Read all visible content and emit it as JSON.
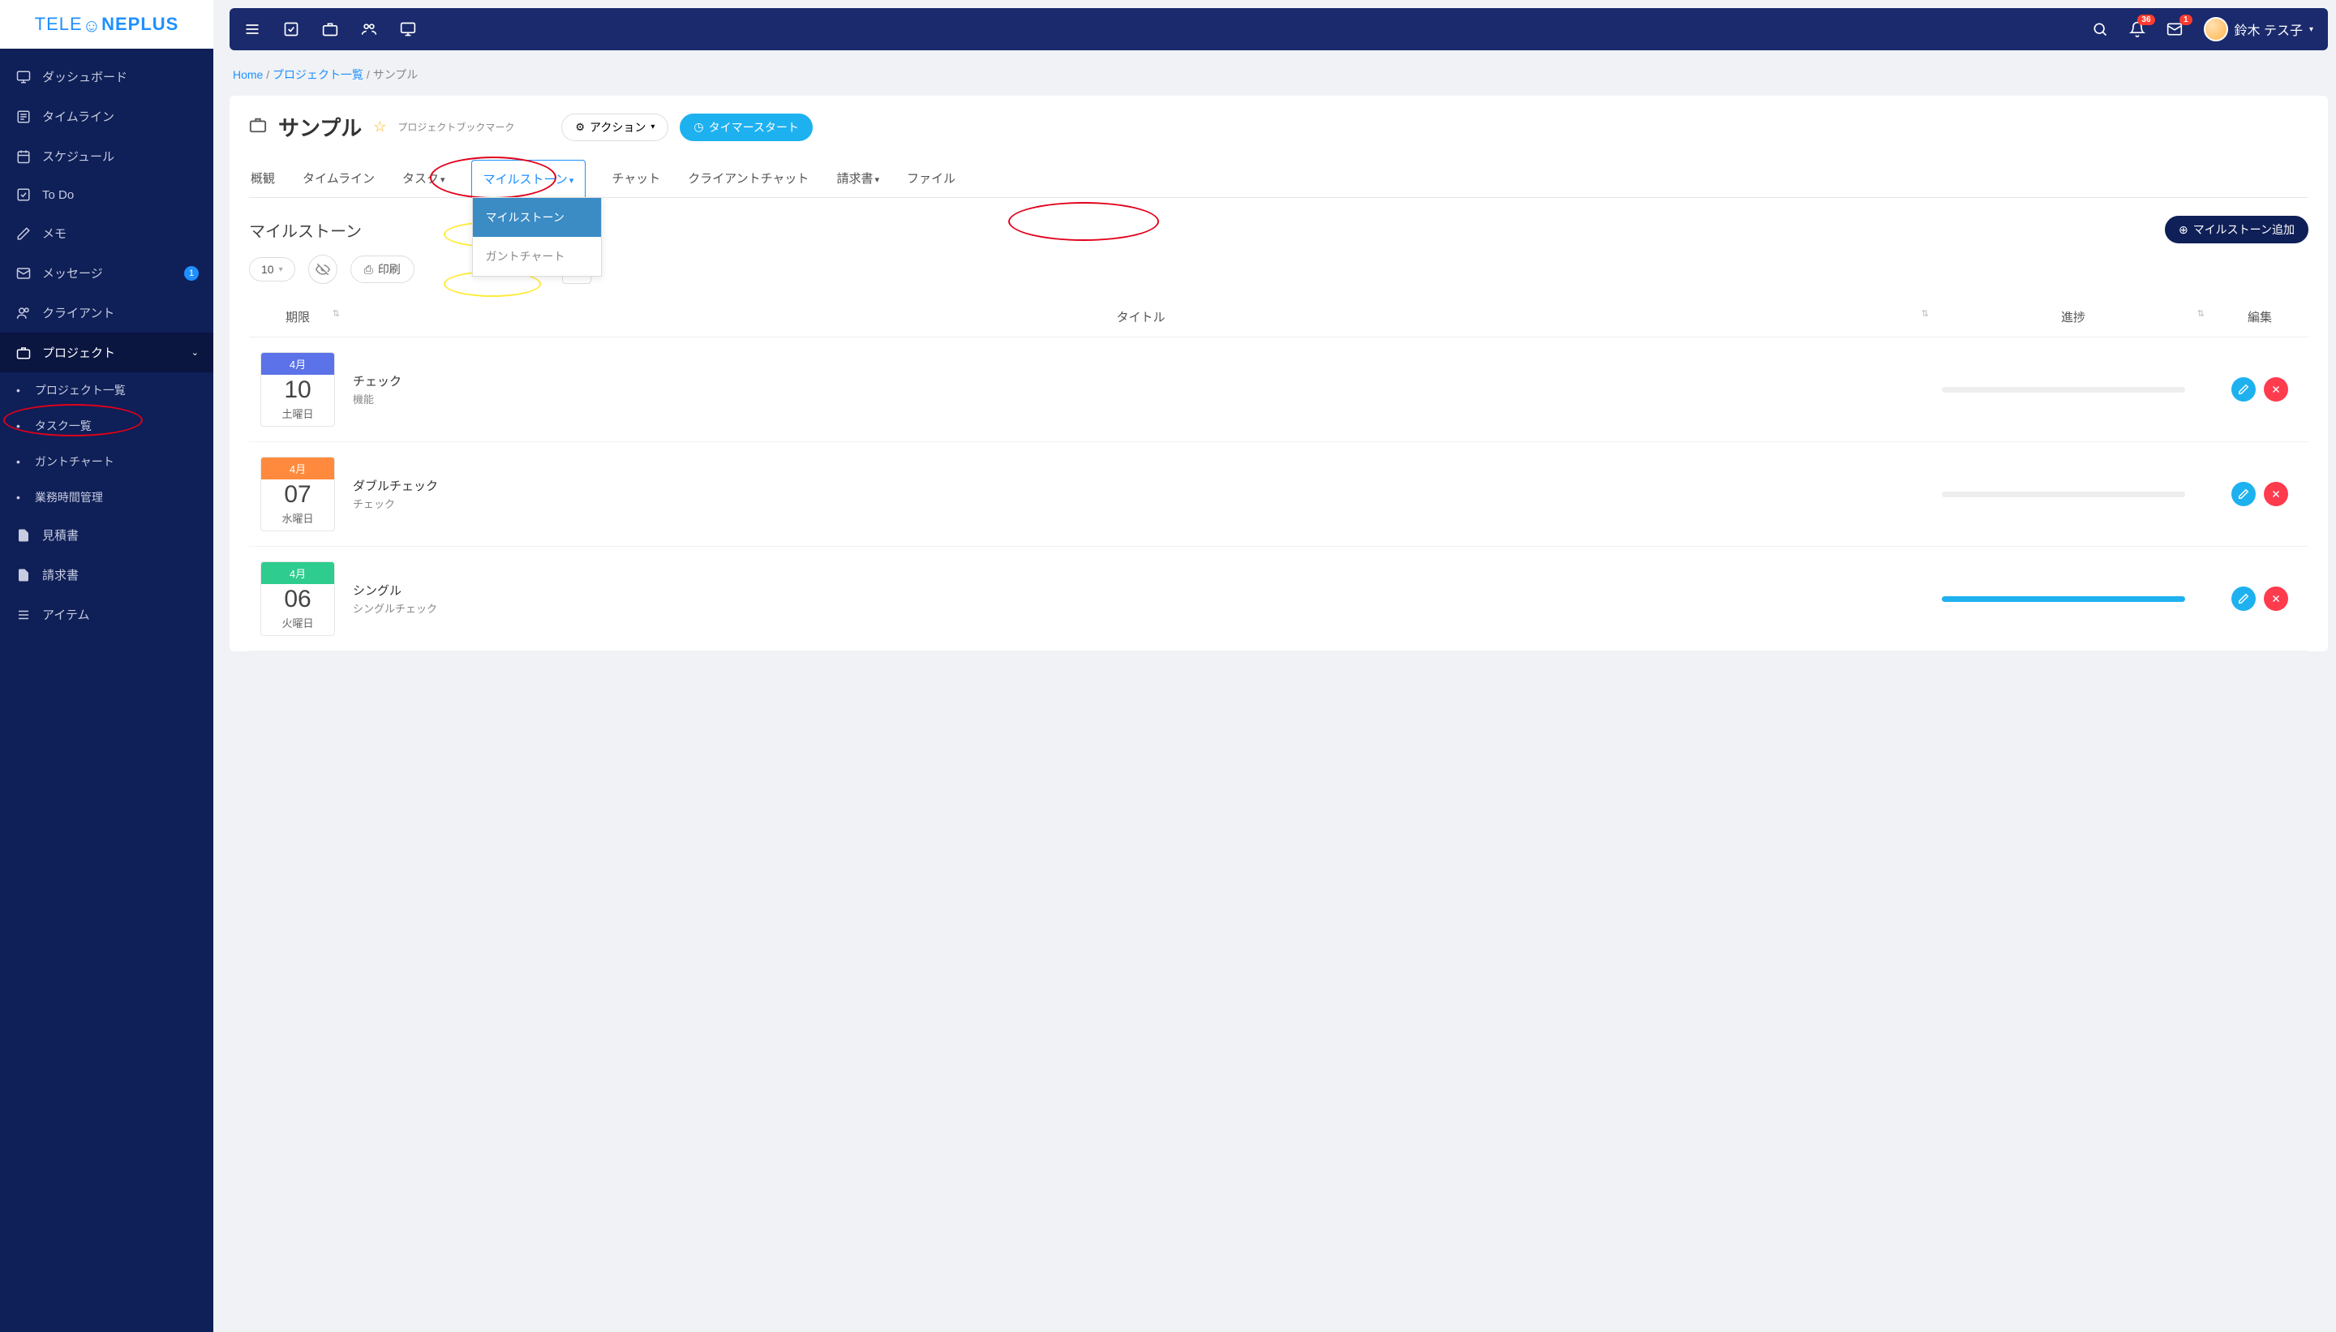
{
  "logo": {
    "t1": "TELE",
    "t2": "NEPLUS"
  },
  "sidebar": [
    {
      "label": "ダッシュボード"
    },
    {
      "label": "タイムライン"
    },
    {
      "label": "スケジュール"
    },
    {
      "label": "To Do"
    },
    {
      "label": "メモ"
    },
    {
      "label": "メッセージ",
      "badge": "1"
    },
    {
      "label": "クライアント"
    },
    {
      "label": "プロジェクト",
      "expand": true
    },
    {
      "label": "見積書"
    },
    {
      "label": "請求書"
    },
    {
      "label": "アイテム"
    }
  ],
  "sub": [
    {
      "label": "プロジェクト一覧"
    },
    {
      "label": "タスク一覧"
    },
    {
      "label": "ガントチャート"
    },
    {
      "label": "業務時間管理"
    }
  ],
  "topbar": {
    "bell_badge": "36",
    "mail_badge": "1",
    "user": "鈴木 テス子"
  },
  "breadcrumb": {
    "home": "Home",
    "list": "プロジェクト一覧",
    "current": "サンプル"
  },
  "project": {
    "title": "サンプル",
    "bookmark": "プロジェクトブックマーク",
    "action": "アクション",
    "timer": "タイマースタート"
  },
  "tabs": {
    "overview": "概観",
    "timeline": "タイムライン",
    "task": "タスク",
    "milestone": "マイルストーン",
    "chat": "チャット",
    "clientchat": "クライアントチャット",
    "invoice": "請求書",
    "file": "ファイル"
  },
  "dropdown": {
    "milestone": "マイルストーン",
    "gantt": "ガントチャート"
  },
  "section": {
    "heading": "マイルストーン",
    "add": "マイルストーン追加"
  },
  "toolbar": {
    "pagesize": "10",
    "print": "印刷"
  },
  "columns": {
    "due": "期限",
    "title": "タイトル",
    "progress": "進捗",
    "edit": "編集"
  },
  "rows": [
    {
      "month": "4月",
      "day": "10",
      "dow": "土曜日",
      "title": "チェック",
      "sub": "機能",
      "progress": 0,
      "color": "#5b72e8"
    },
    {
      "month": "4月",
      "day": "07",
      "dow": "水曜日",
      "title": "ダブルチェック",
      "sub": "チェック",
      "progress": 0,
      "color": "#ff8a3d"
    },
    {
      "month": "4月",
      "day": "06",
      "dow": "火曜日",
      "title": "シングル",
      "sub": "シングルチェック",
      "progress": 100,
      "color": "#2ecc8f"
    }
  ]
}
